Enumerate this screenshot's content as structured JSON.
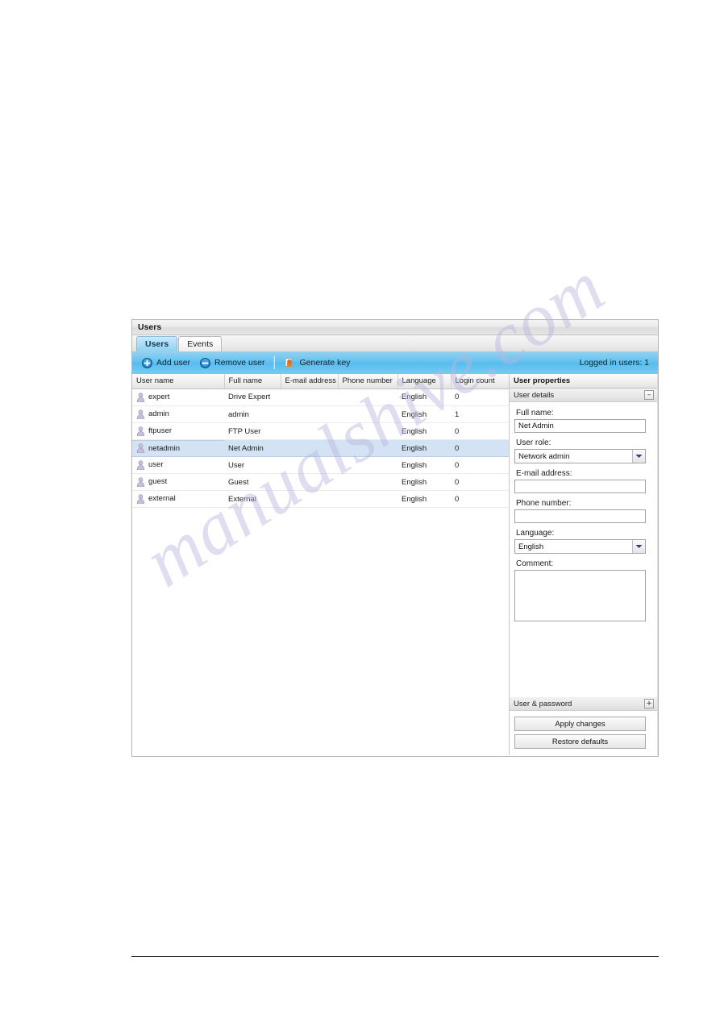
{
  "window": {
    "title": "Users"
  },
  "tabs": [
    {
      "label": "Users",
      "active": true
    },
    {
      "label": "Events",
      "active": false
    }
  ],
  "toolbar": {
    "add_user_label": "Add user",
    "remove_user_label": "Remove user",
    "generate_key_label": "Generate key",
    "status_label": "Logged in users: 1",
    "icons": {
      "add": "plus-circle-icon",
      "remove": "minus-circle-icon",
      "key": "key-icon"
    },
    "accent_color": "#5dc0ef"
  },
  "table": {
    "columns": [
      "User name",
      "Full name",
      "E-mail address",
      "Phone number",
      "Language",
      "Login count"
    ],
    "rows": [
      {
        "user_name": "expert",
        "full_name": "Drive Expert",
        "email": "",
        "phone": "",
        "language": "English",
        "login_count": "0",
        "selected": false
      },
      {
        "user_name": "admin",
        "full_name": "admin",
        "email": "",
        "phone": "",
        "language": "English",
        "login_count": "1",
        "selected": false
      },
      {
        "user_name": "ftpuser",
        "full_name": "FTP User",
        "email": "",
        "phone": "",
        "language": "English",
        "login_count": "0",
        "selected": false
      },
      {
        "user_name": "netadmin",
        "full_name": "Net Admin",
        "email": "",
        "phone": "",
        "language": "English",
        "login_count": "0",
        "selected": true
      },
      {
        "user_name": "user",
        "full_name": "User",
        "email": "",
        "phone": "",
        "language": "English",
        "login_count": "0",
        "selected": false
      },
      {
        "user_name": "guest",
        "full_name": "Guest",
        "email": "",
        "phone": "",
        "language": "English",
        "login_count": "0",
        "selected": false
      },
      {
        "user_name": "external",
        "full_name": "External",
        "email": "",
        "phone": "",
        "language": "English",
        "login_count": "0",
        "selected": false
      }
    ],
    "selection_color": "#d3e3f3"
  },
  "properties": {
    "header": "User properties",
    "user_details": {
      "section_label": "User details",
      "toggle_glyph": "–",
      "full_name_label": "Full name:",
      "full_name_value": "Net Admin",
      "user_role_label": "User role:",
      "user_role_value": "Network admin",
      "email_label": "E-mail address:",
      "email_value": "",
      "phone_label": "Phone number:",
      "phone_value": "",
      "language_label": "Language:",
      "language_value": "English",
      "comment_label": "Comment:",
      "comment_value": ""
    },
    "user_password": {
      "section_label": "User & password",
      "toggle_glyph": "+"
    },
    "buttons": {
      "apply": "Apply changes",
      "restore": "Restore defaults"
    }
  },
  "watermark": {
    "text": "manualshive.com"
  }
}
